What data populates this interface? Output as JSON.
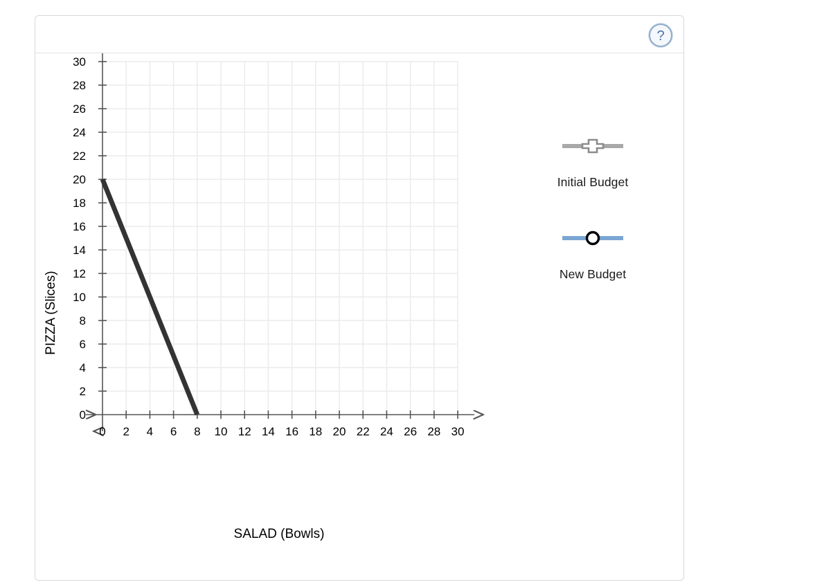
{
  "panel": {
    "help_button": {
      "icon": "question-mark-circle-icon",
      "label": "?",
      "color": "#4a72a8"
    }
  },
  "chart_data": {
    "type": "line",
    "title": "",
    "xlabel": "SALAD (Bowls)",
    "ylabel": "PIZZA (Slices)",
    "xlim": [
      0,
      30
    ],
    "ylim": [
      0,
      30
    ],
    "xticks": [
      0,
      2,
      4,
      6,
      8,
      10,
      12,
      14,
      16,
      18,
      20,
      22,
      24,
      26,
      28,
      30
    ],
    "yticks": [
      0,
      2,
      4,
      6,
      8,
      10,
      12,
      14,
      16,
      18,
      20,
      22,
      24,
      26,
      28,
      30
    ],
    "grid": true,
    "grid_step": 2,
    "legend_position": "right",
    "series": [
      {
        "name": "Initial Budget",
        "color": "#333333",
        "marker": "cross",
        "legend_line_color": "#a8a8a8",
        "points": [
          {
            "x": 0,
            "y": 20
          },
          {
            "x": 8,
            "y": 0
          }
        ],
        "drawn": true
      },
      {
        "name": "New Budget",
        "color": "#7aa6d2",
        "marker": "open-circle",
        "legend_line_color": "#7aa6d2",
        "points": [],
        "drawn": false
      }
    ]
  },
  "legend": {
    "entries": [
      {
        "label": "Initial Budget"
      },
      {
        "label": "New Budget"
      }
    ]
  }
}
